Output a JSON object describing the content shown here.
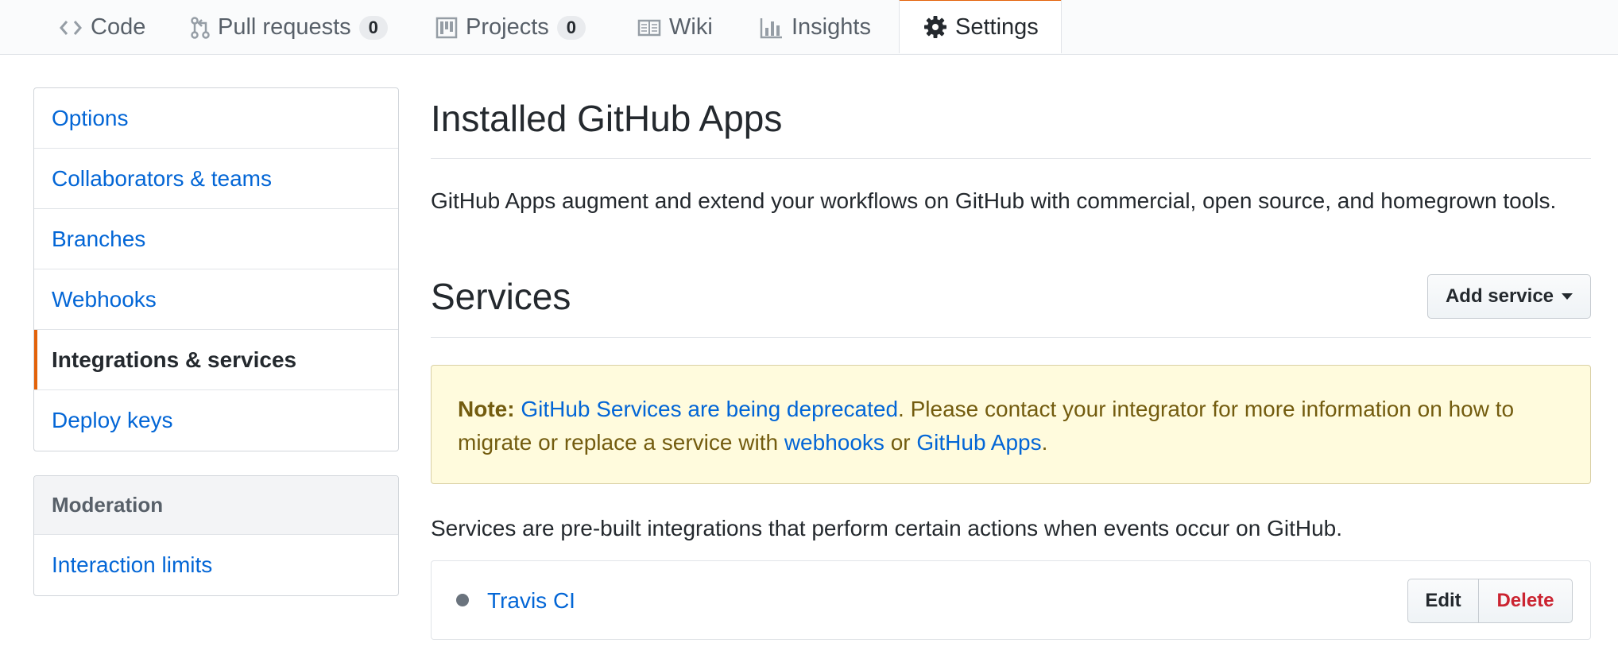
{
  "tabs": [
    {
      "label": "Code",
      "icon": "code-icon"
    },
    {
      "label": "Pull requests",
      "icon": "git-pull-request-icon",
      "count": "0"
    },
    {
      "label": "Projects",
      "icon": "project-icon",
      "count": "0"
    },
    {
      "label": "Wiki",
      "icon": "book-icon"
    },
    {
      "label": "Insights",
      "icon": "graph-icon"
    },
    {
      "label": "Settings",
      "icon": "gear-icon",
      "selected": true
    }
  ],
  "sidebar": {
    "items": [
      {
        "label": "Options"
      },
      {
        "label": "Collaborators & teams"
      },
      {
        "label": "Branches"
      },
      {
        "label": "Webhooks"
      },
      {
        "label": "Integrations & services",
        "selected": true
      },
      {
        "label": "Deploy keys"
      }
    ],
    "moderation": {
      "heading": "Moderation",
      "items": [
        {
          "label": "Interaction limits"
        }
      ]
    }
  },
  "main": {
    "apps_title": "Installed GitHub Apps",
    "apps_description": "GitHub Apps augment and extend your workflows on GitHub with commercial, open source, and homegrown tools.",
    "services_title": "Services",
    "add_service_label": "Add service",
    "note": {
      "label": "Note:",
      "link1": "GitHub Services are being deprecated",
      "text1": ". Please contact your integrator for more information on how to migrate or replace a service with ",
      "link2": "webhooks",
      "text2": " or ",
      "link3": "GitHub Apps",
      "text3": "."
    },
    "services_description": "Services are pre-built integrations that perform certain actions when events occur on GitHub.",
    "services": [
      {
        "name": "Travis CI",
        "edit_label": "Edit",
        "delete_label": "Delete"
      }
    ]
  },
  "colors": {
    "accent": "#e36209",
    "link": "#0366d6",
    "danger": "#cb2431",
    "flash_bg": "#fffbdd",
    "flash_text": "#735c0f"
  }
}
